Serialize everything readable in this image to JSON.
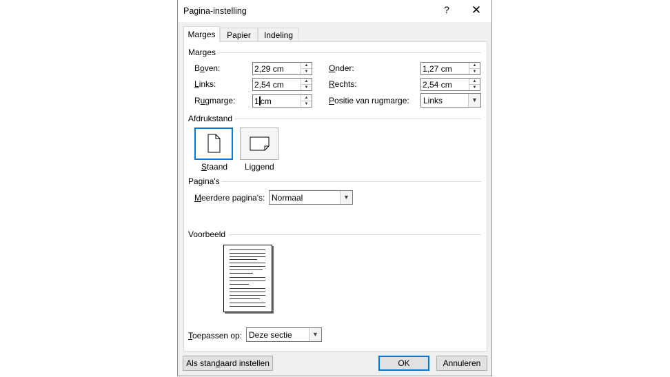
{
  "dialog": {
    "title": "Pagina-instelling",
    "help_label": "?",
    "close_label": "✕"
  },
  "tabs": [
    {
      "label": "Marges",
      "active": true
    },
    {
      "label": "Papier",
      "active": false
    },
    {
      "label": "Indeling",
      "active": false
    }
  ],
  "margins": {
    "group_label": "Marges",
    "top": {
      "label_pre": "B",
      "label_u": "o",
      "label_post": "ven:",
      "value": "2,29 cm"
    },
    "left": {
      "label_pre": "",
      "label_u": "L",
      "label_post": "inks:",
      "value": "2,54 cm"
    },
    "gutter": {
      "label_pre": "R",
      "label_u": "u",
      "label_post": "gmarge:",
      "value_pre": "1",
      "value_post": "cm"
    },
    "bottom": {
      "label_pre": "",
      "label_u": "O",
      "label_post": "nder:",
      "value": "1,27 cm"
    },
    "right": {
      "label_pre": "",
      "label_u": "R",
      "label_post": "echts:",
      "value": "2,54 cm"
    },
    "gutter_pos": {
      "label_pre": "",
      "label_u": "P",
      "label_post": "ositie van rugmarge:",
      "value": "Links"
    }
  },
  "orientation": {
    "group_label": "Afdrukstand",
    "portrait": {
      "label_pre": "",
      "label_u": "S",
      "label_post": "taand",
      "selected": true
    },
    "landscape": {
      "label_pre": "Lig",
      "label_u": "g",
      "label_post": "end",
      "selected": false
    }
  },
  "pages": {
    "group_label": "Pagina's",
    "multiple_label_pre": "",
    "multiple_label_u": "M",
    "multiple_label_post": "eerdere pagina's:",
    "multiple_value": "Normaal"
  },
  "preview": {
    "group_label": "Voorbeeld"
  },
  "apply": {
    "label_pre": "",
    "label_u": "T",
    "label_post": "oepassen op:",
    "value": "Deze sectie"
  },
  "footer": {
    "default_pre": "Als stan",
    "default_u": "d",
    "default_post": "aard instellen",
    "ok_label": "OK",
    "cancel_label": "Annuleren"
  },
  "icons": {
    "spin_up": "spin-up-arrow",
    "spin_down": "spin-down-arrow",
    "dropdown": "chevron-down-icon",
    "portrait": "portrait-page-icon",
    "landscape": "landscape-page-icon"
  }
}
